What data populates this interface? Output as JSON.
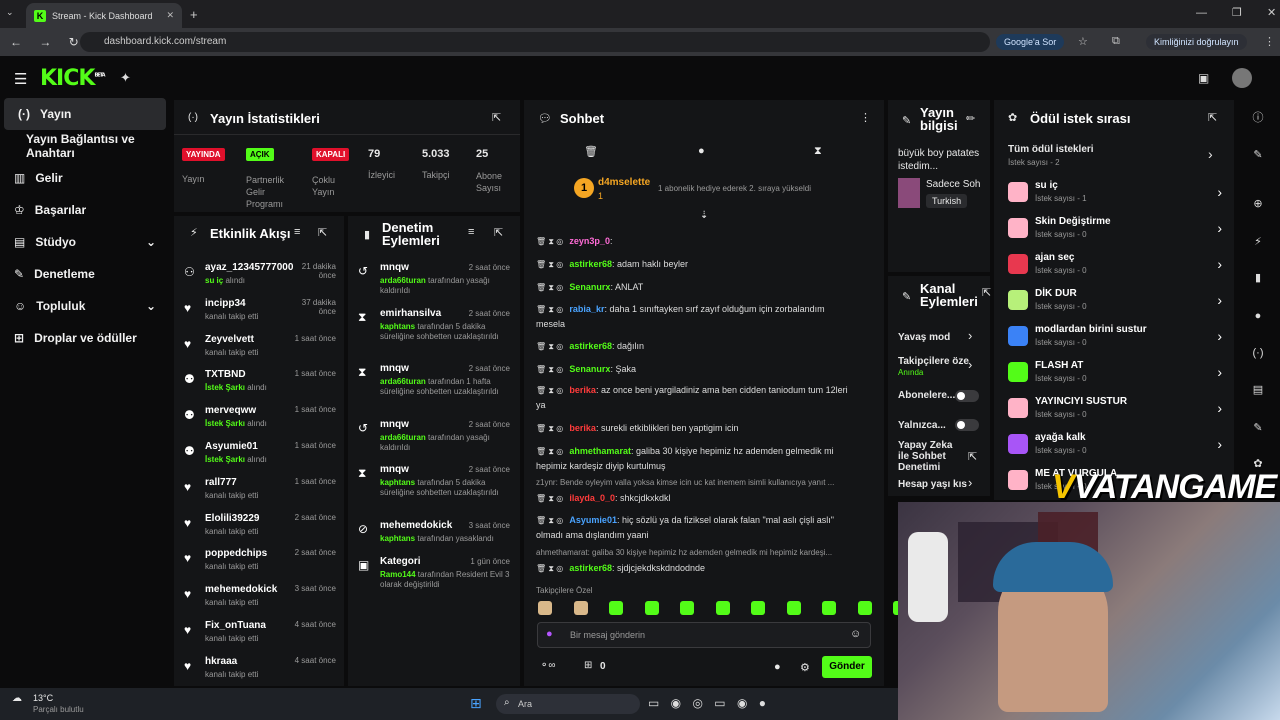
{
  "browser": {
    "tab_title": "Stream - Kick Dashboard",
    "url": "dashboard.kick.com/stream",
    "google_btn": "Google'a Sor",
    "identity_btn": "Kimliğinizi doğrulayın"
  },
  "kick": {
    "logo": "KICK",
    "beta": "BETA"
  },
  "sidebar": {
    "items": [
      {
        "label": "Yayın",
        "icon": "broadcast-icon"
      },
      {
        "label": "Yayın Bağlantısı ve Anahtarı",
        "icon": ""
      },
      {
        "label": "Gelir",
        "icon": "chart-icon"
      },
      {
        "label": "Başarılar",
        "icon": "trophy-icon"
      },
      {
        "label": "Stüdyo",
        "icon": "studio-icon"
      },
      {
        "label": "Denetleme",
        "icon": "wrench-icon"
      },
      {
        "label": "Topluluk",
        "icon": "community-icon"
      },
      {
        "label": "Droplar ve ödüller",
        "icon": "gift-icon"
      }
    ]
  },
  "stats": {
    "title": "Yayın İstatistikleri",
    "live_badge": "YAYINDA",
    "live_label": "Yayın",
    "open_badge": "AÇIK",
    "open_label": "Partnerlik Gelir Programı",
    "closed_badge": "KAPALI",
    "closed_label": "Çoklu Yayın",
    "viewers": "79",
    "viewers_label": "İzleyici",
    "followers": "5.033",
    "followers_label": "Takipçi",
    "subs": "25",
    "subs_label": "Abone Sayısı"
  },
  "activity": {
    "title": "Etkinlik Akışı",
    "items": [
      {
        "user": "ayaz_12345777000",
        "time": "21 dakika önce",
        "action": "su iç",
        "suffix": " alındı"
      },
      {
        "user": "incipp34",
        "time": "37 dakika önce",
        "action": "",
        "suffix": "kanalı takip etti"
      },
      {
        "user": "Zeyvelvett",
        "time": "1 saat önce",
        "action": "",
        "suffix": "kanalı takip etti"
      },
      {
        "user": "TXTBND",
        "time": "1 saat önce",
        "action": "İstek Şarkı",
        "suffix": " alındı"
      },
      {
        "user": "merveqww",
        "time": "1 saat önce",
        "action": "İstek Şarkı",
        "suffix": " alındı"
      },
      {
        "user": "Asyumie01",
        "time": "1 saat önce",
        "action": "İstek Şarkı",
        "suffix": " alındı"
      },
      {
        "user": "rall777",
        "time": "1 saat önce",
        "action": "",
        "suffix": "kanalı takip etti"
      },
      {
        "user": "Elolili39229",
        "time": "2 saat önce",
        "action": "",
        "suffix": "kanalı takip etti"
      },
      {
        "user": "poppedchips",
        "time": "2 saat önce",
        "action": "",
        "suffix": "kanalı takip etti"
      },
      {
        "user": "mehemedokick",
        "time": "3 saat önce",
        "action": "",
        "suffix": "kanalı takip etti"
      },
      {
        "user": "Fix_onTuana",
        "time": "4 saat önce",
        "action": "",
        "suffix": "kanalı takip etti"
      },
      {
        "user": "hkraaa",
        "time": "4 saat önce",
        "action": "",
        "suffix": "kanalı takip etti"
      }
    ]
  },
  "moderation": {
    "title": "Denetim Eylemleri",
    "items": [
      {
        "user": "mnqw",
        "time": "2 saat önce",
        "actor": "arda66turan",
        "text": " tarafından yasağı kaldırıldı"
      },
      {
        "user": "emirhansilva",
        "time": "2 saat önce",
        "actor": "kaphtans",
        "text": " tarafından 5 dakika süreliğine sohbetten uzaklaştırıldı"
      },
      {
        "user": "mnqw",
        "time": "2 saat önce",
        "actor": "arda66turan",
        "text": " tarafından 1 hafta süreliğine sohbetten uzaklaştırıldı"
      },
      {
        "user": "mnqw",
        "time": "2 saat önce",
        "actor": "arda66turan",
        "text": " tarafından yasağı kaldırıldı"
      },
      {
        "user": "mnqw",
        "time": "2 saat önce",
        "actor": "kaphtans",
        "text": " tarafından 5 dakika süreliğine sohbetten uzaklaştırıldı"
      },
      {
        "user": "mehemedokick",
        "time": "3 saat önce",
        "actor": "kaphtans",
        "text": " tarafından yasaklandı"
      },
      {
        "user": "Kategori",
        "time": "1 gün önce",
        "actor": "Ramo144",
        "text": " tarafından Resident Evil 3 olarak değiştirildi"
      }
    ]
  },
  "chat": {
    "title": "Sohbet",
    "pinned_user": "d4mselette",
    "pinned_text": "1 abonelik hediye ederek 2. sıraya yükseldi",
    "pinned_count": "1",
    "messages": [
      {
        "user": "zeyn3p_0",
        "text": "",
        "color": "#ff6bd6"
      },
      {
        "user": "astirker68",
        "text": "adam haklı beyler",
        "color": "#53fc18"
      },
      {
        "user": "Senanurx",
        "text": "ANLAT",
        "color": "#53fc18"
      },
      {
        "user": "rabia_kr",
        "text": "daha 1 sınıftayken sırf zayıf olduğum için zorbalandım mesela",
        "color": "#4aa3ff"
      },
      {
        "user": "astirker68",
        "text": "dağılın",
        "color": "#53fc18"
      },
      {
        "user": "Senanurx",
        "text": "Şaka",
        "color": "#53fc18"
      },
      {
        "user": "berika",
        "text": "az once beni yargiladiniz ama ben cidden taniodum tum 12leri ya",
        "color": "#ff3b3b"
      },
      {
        "user": "berika",
        "text": "surekli etkiblikleri ben yaptigim icin",
        "color": "#ff3b3b"
      },
      {
        "user": "ahmethamarat",
        "text": "galiba 30 kişiye hepimiz hz ademden gelmedik mi hepimiz kardeşiz diyip kurtulmuş",
        "color": "#53fc18"
      },
      {
        "user": "ilayda_0_0",
        "text": "shkcjdkxkdkl",
        "color": "#ff3b3b"
      },
      {
        "user": "Asyumie01",
        "text": "hiç sözlü ya da fiziksel olarak falan \"mal aslı çişli aslı\" olmadı ama dışlandım yaani",
        "color": "#4aa3ff"
      },
      {
        "user": "astirker68",
        "text": "sjdjcjekdkskdndodnde",
        "color": "#53fc18"
      }
    ],
    "reply1": "z1ynr: Bende oyleyim valla yoksa kimse icin uc kat inemem isimli kullanıcıya yanıt ...",
    "reply2": "ahmethamarat: galiba 30 kişiye hepimiz hz ademden gelmedik mi hepimiz kardeşi...",
    "followers_only": "Takipçilere Özel",
    "placeholder": "Bir mesaj gönderin",
    "points": "0",
    "send": "Gönder"
  },
  "info": {
    "title": "Yayın bilgisi",
    "stream_title": "büyük boy patates istedim...",
    "category": "Sadece Soh",
    "language": "Turkish"
  },
  "channel": {
    "title": "Kanal Eylemleri",
    "slow": "Yavaş mod",
    "followers": "Takipçilere öze",
    "followers_sub": "Anında",
    "subs": "Abonelere...",
    "only": "Yalnızca...",
    "ai": "Yapay Zeka ile Sohbet Denetimi",
    "age": "Hesap yaşı kıs"
  },
  "rewards": {
    "title": "Ödül istek sırası",
    "all": "Tüm ödül istekleri",
    "all_count": "İstek sayısı - 2",
    "items": [
      {
        "name": "su iç",
        "count": "İstek sayısı - 1",
        "color": "#ffb3c7"
      },
      {
        "name": "Skin Değiştirme",
        "count": "İstek sayısı - 0",
        "color": "#ffb3c7"
      },
      {
        "name": "ajan seç",
        "count": "İstek sayısı - 0",
        "color": "#e8384f"
      },
      {
        "name": "DİK DUR",
        "count": "İstek sayısı - 0",
        "color": "#b7f07a"
      },
      {
        "name": "modlardan birini sustur",
        "count": "İstek sayısı - 0",
        "color": "#3b82f6"
      },
      {
        "name": "FLASH AT",
        "count": "İstek sayısı - 0",
        "color": "#53fc18"
      },
      {
        "name": "YAYINCIYI SUSTUR",
        "count": "İstek sayısı - 0",
        "color": "#ffb3c7"
      },
      {
        "name": "ayağa kalk",
        "count": "İstek sayısı - 0",
        "color": "#a855f7"
      },
      {
        "name": "ME AT VURGULA",
        "count": "İstek sayısı - 0",
        "color": "#ffb3c7"
      }
    ]
  },
  "overlay": {
    "brand": "VATANGAME",
    ".com": ".com"
  },
  "taskbar": {
    "temp": "13°C",
    "weather": "Parçalı bulutlu",
    "search": "Ara"
  }
}
